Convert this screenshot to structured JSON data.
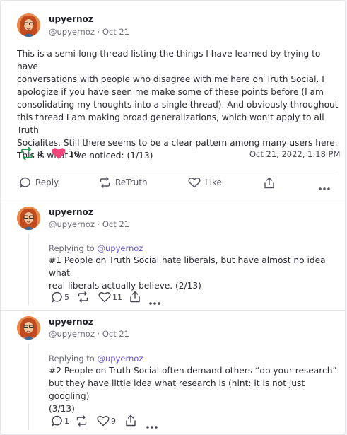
{
  "main_post": {
    "display_name": "upyernoz",
    "handle_date": "@upyernoz · Oct 21",
    "text_lines": [
      "This is a semi-long thread listing the things I have learned by trying to have",
      "conversations with people who disagree with me here on Truth Social. I",
      "apologize if you have seen me make some of these points before (I am",
      "consolidating my thoughts into a single thread). And obviously throughout",
      "this thread I am making broad generalizations, which won’t apply to all Truth",
      "Socialites. Still there seems to be a clear pattern among many users here.",
      "This is what I’ve noticed: (1/13)"
    ],
    "retruth_count": "4",
    "like_count": "10",
    "timestamp": "Oct 21, 2022, 1:18 PM",
    "actions": {
      "reply": "Reply",
      "retruth": "ReTruth",
      "like": "Like"
    },
    "colors": {
      "retruth": "#22a05a",
      "like": "#f0457a",
      "mention": "#6a54d6"
    }
  },
  "replies": [
    {
      "display_name": "upyernoz",
      "handle_date": "@upyernoz · Oct 21",
      "replying_prefix": "Replying to ",
      "replying_to": "@upyernoz",
      "text_lines": [
        "#1 People on Truth Social hate liberals, but have almost no idea what",
        "real liberals actually believe. (2/13)"
      ],
      "reply_count": "5",
      "retruth_count": "",
      "like_count": "11"
    },
    {
      "display_name": "upyernoz",
      "handle_date": "@upyernoz · Oct 21",
      "replying_prefix": "Replying to ",
      "replying_to": "@upyernoz",
      "text_lines": [
        "#2 People on Truth Social often demand others “do your research”",
        "but they have little idea what research is (hint: it is not just googling)",
        "(3/13)"
      ],
      "reply_count": "1",
      "retruth_count": "",
      "like_count": "9"
    }
  ]
}
